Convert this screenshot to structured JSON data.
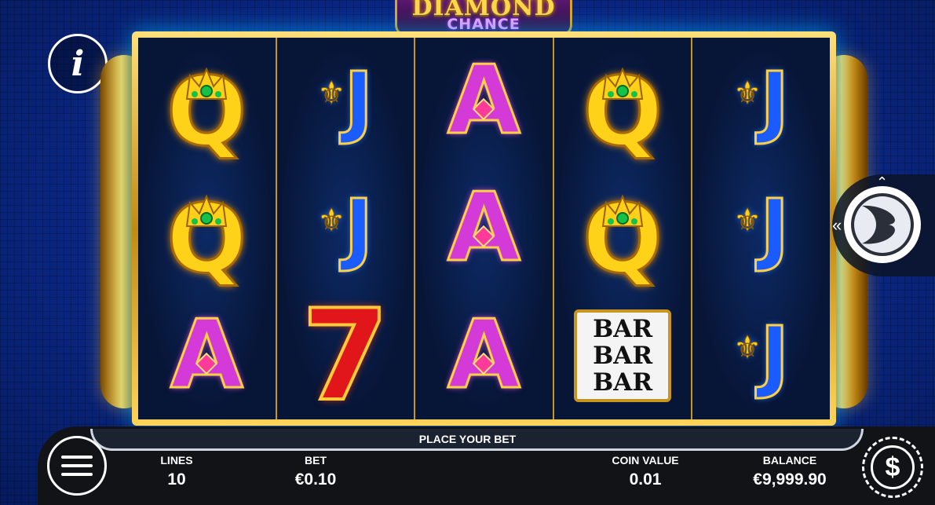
{
  "logo": {
    "line1": "DIAMOND",
    "line2": "CHANCE"
  },
  "info": {
    "glyph": "i",
    "icon": "info-icon"
  },
  "reels": [
    [
      "Q",
      "Q",
      "A"
    ],
    [
      "J",
      "J",
      "7"
    ],
    [
      "A",
      "A",
      "A"
    ],
    [
      "Q",
      "Q",
      "BAR"
    ],
    [
      "J",
      "J",
      "J"
    ]
  ],
  "bar_symbol": {
    "line1": "BAR",
    "line2": "BAR",
    "line3": "BAR"
  },
  "panel": {
    "prompt": "PLACE YOUR BET",
    "lines_label": "LINES",
    "lines_value": "10",
    "bet_label": "BET",
    "bet_value": "€0.10",
    "coin_label": "COIN VALUE",
    "coin_value": "0.01",
    "balance_label": "BALANCE",
    "balance_value": "€9,999.90"
  },
  "coin_button": {
    "glyph": "$"
  },
  "colors": {
    "frame_gold": "#d9a520",
    "background_blue": "#0b2a8e",
    "panel": "#111316"
  }
}
